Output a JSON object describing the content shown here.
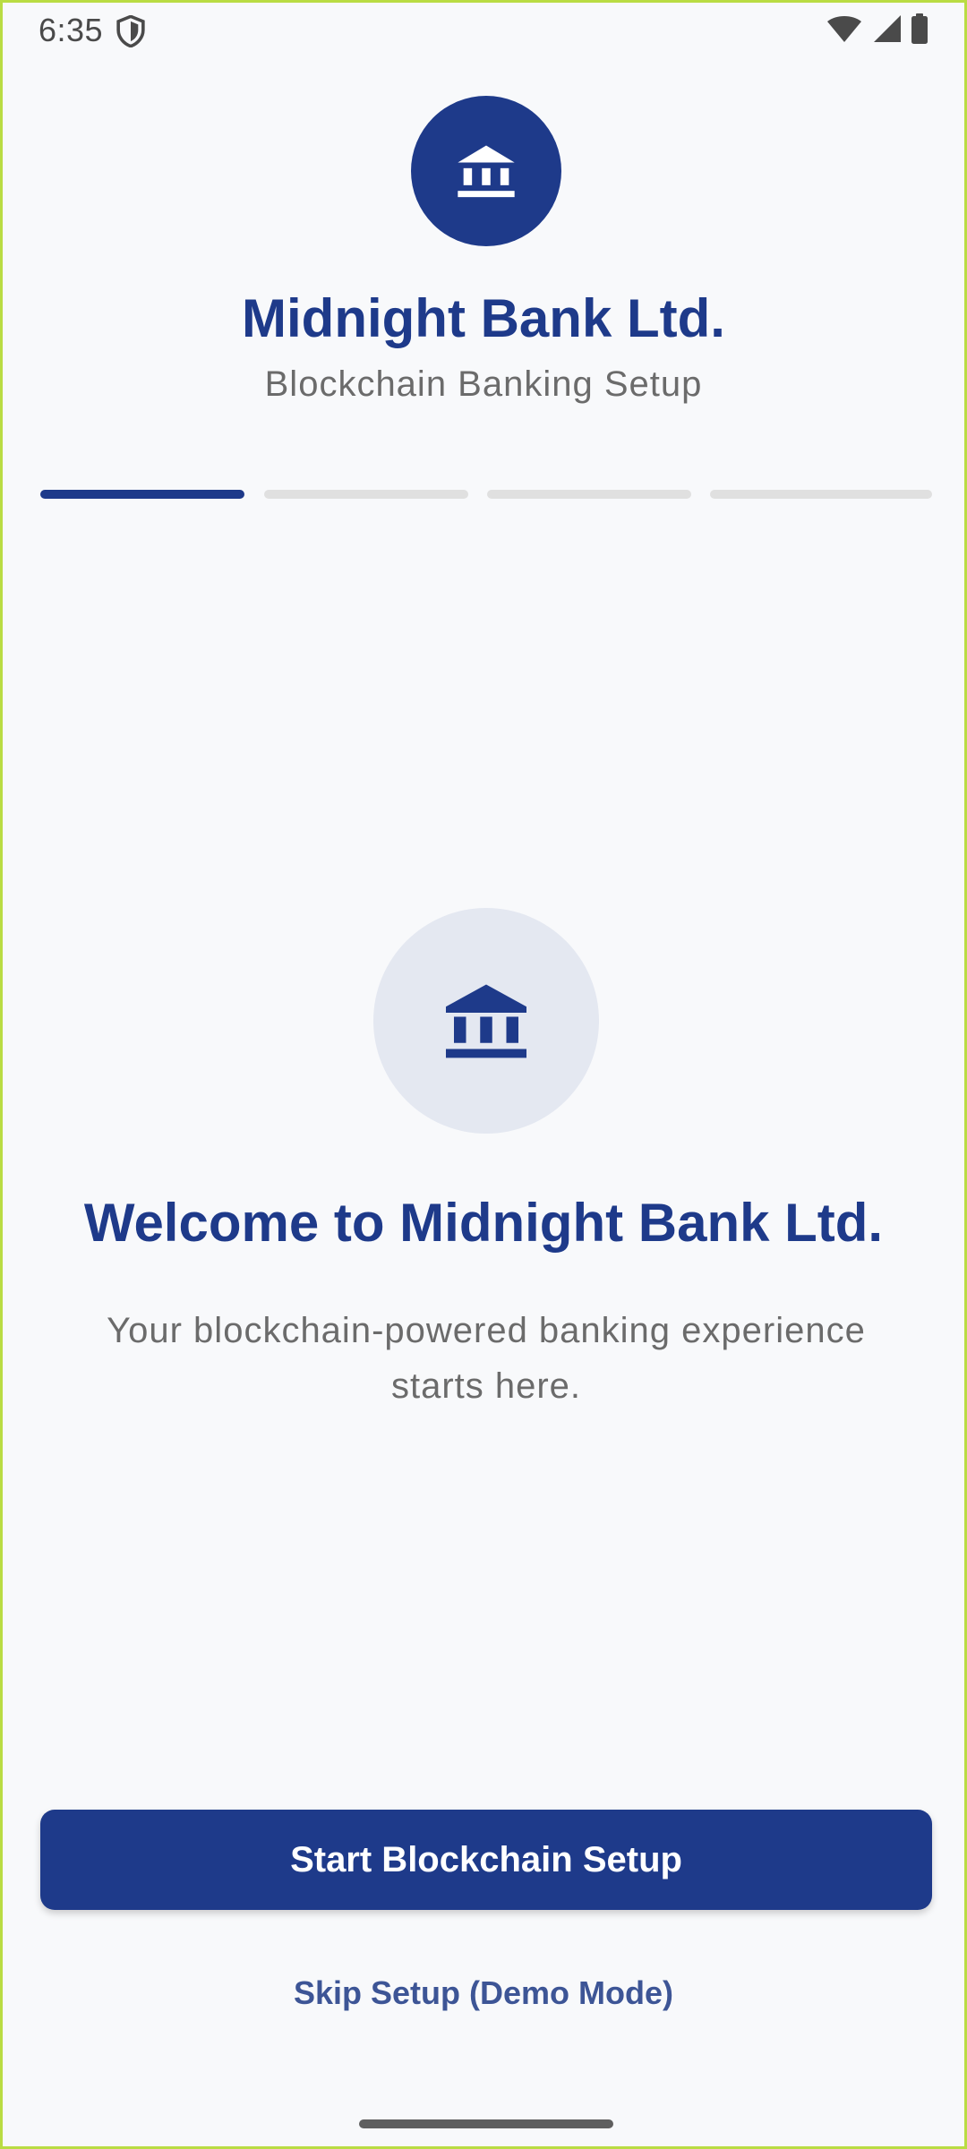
{
  "status_bar": {
    "time": "6:35",
    "icons": [
      "shield-icon",
      "wifi-icon",
      "signal-icon",
      "battery-icon"
    ]
  },
  "header": {
    "logo_icon": "bank-icon",
    "title": "Midnight Bank Ltd.",
    "subtitle": "Blockchain Banking Setup"
  },
  "progress": {
    "total_steps": 4,
    "current_step": 1
  },
  "welcome": {
    "icon": "bank-icon",
    "title": "Welcome to Midnight Bank Ltd.",
    "description": "Your blockchain-powered banking experience starts here."
  },
  "actions": {
    "primary_label": "Start Blockchain Setup",
    "skip_label": "Skip Setup (Demo Mode)"
  },
  "colors": {
    "brand": "#1e3a8a",
    "background": "#f8f9fb",
    "icon_circle_bg": "#e4e8f1",
    "inactive_step": "#e0e0e0",
    "secondary_text": "#6b6b6b",
    "link": "#3d5596"
  }
}
